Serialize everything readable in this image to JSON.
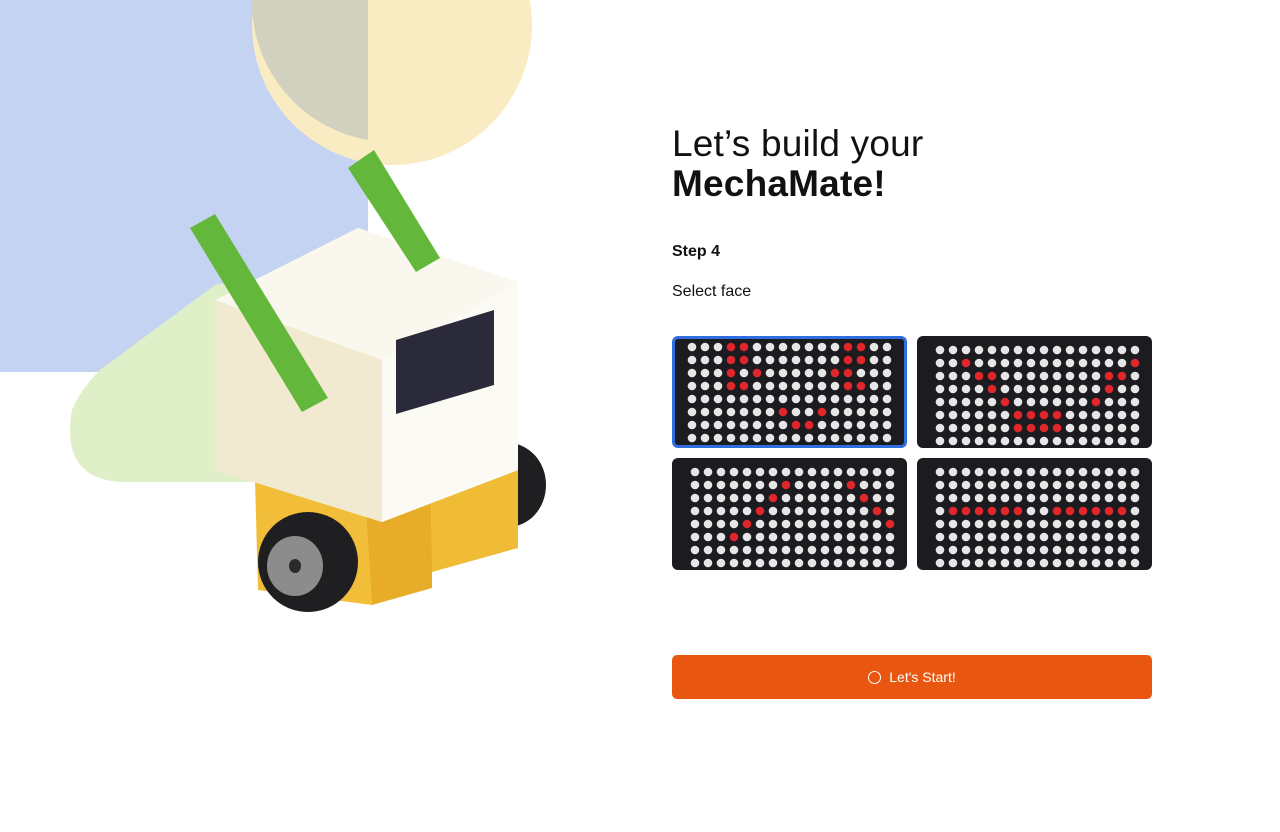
{
  "header": {
    "title_line1": "Let’s build your",
    "title_line2": "MechaMate!"
  },
  "step": {
    "label": "Step 4",
    "instruction": "Select face"
  },
  "faces": [
    {
      "selected": true,
      "lit": [
        [
          3,
          0
        ],
        [
          3,
          1
        ],
        [
          3,
          2
        ],
        [
          3,
          3
        ],
        [
          4,
          0
        ],
        [
          4,
          1
        ],
        [
          4,
          3
        ],
        [
          5,
          2
        ],
        [
          12,
          0
        ],
        [
          12,
          1
        ],
        [
          12,
          2
        ],
        [
          12,
          3
        ],
        [
          13,
          0
        ],
        [
          13,
          1
        ],
        [
          13,
          3
        ],
        [
          11,
          2
        ],
        [
          7,
          5
        ],
        [
          8,
          6
        ],
        [
          9,
          6
        ],
        [
          10,
          5
        ]
      ]
    },
    {
      "selected": false,
      "lit": [
        [
          2,
          1
        ],
        [
          3,
          2
        ],
        [
          4,
          2
        ],
        [
          4,
          3
        ],
        [
          5,
          4
        ],
        [
          15,
          1
        ],
        [
          14,
          2
        ],
        [
          13,
          2
        ],
        [
          13,
          3
        ],
        [
          12,
          4
        ],
        [
          6,
          5
        ],
        [
          7,
          5
        ],
        [
          8,
          5
        ],
        [
          9,
          5
        ],
        [
          6,
          6
        ],
        [
          7,
          6
        ],
        [
          8,
          6
        ],
        [
          9,
          6
        ]
      ]
    },
    {
      "selected": false,
      "lit": [
        [
          7,
          1
        ],
        [
          6,
          2
        ],
        [
          5,
          3
        ],
        [
          4,
          4
        ],
        [
          3,
          5
        ],
        [
          12,
          1
        ],
        [
          13,
          2
        ],
        [
          14,
          3
        ],
        [
          15,
          4
        ],
        [
          16,
          5
        ]
      ]
    },
    {
      "selected": false,
      "lit": [
        [
          1,
          3
        ],
        [
          2,
          3
        ],
        [
          3,
          3
        ],
        [
          4,
          3
        ],
        [
          5,
          3
        ],
        [
          6,
          3
        ],
        [
          9,
          3
        ],
        [
          10,
          3
        ],
        [
          11,
          3
        ],
        [
          12,
          3
        ],
        [
          13,
          3
        ],
        [
          14,
          3
        ]
      ]
    }
  ],
  "colors": {
    "accent": "#e8560f",
    "selected_border": "#2f6de0",
    "led_on": "#e0262a",
    "led_off": "#e6e6e6",
    "panel_bg": "#1c1c20"
  },
  "icons": {
    "start_button_icon": "spinner-icon"
  },
  "actions": {
    "start_label": "Let's Start!"
  }
}
